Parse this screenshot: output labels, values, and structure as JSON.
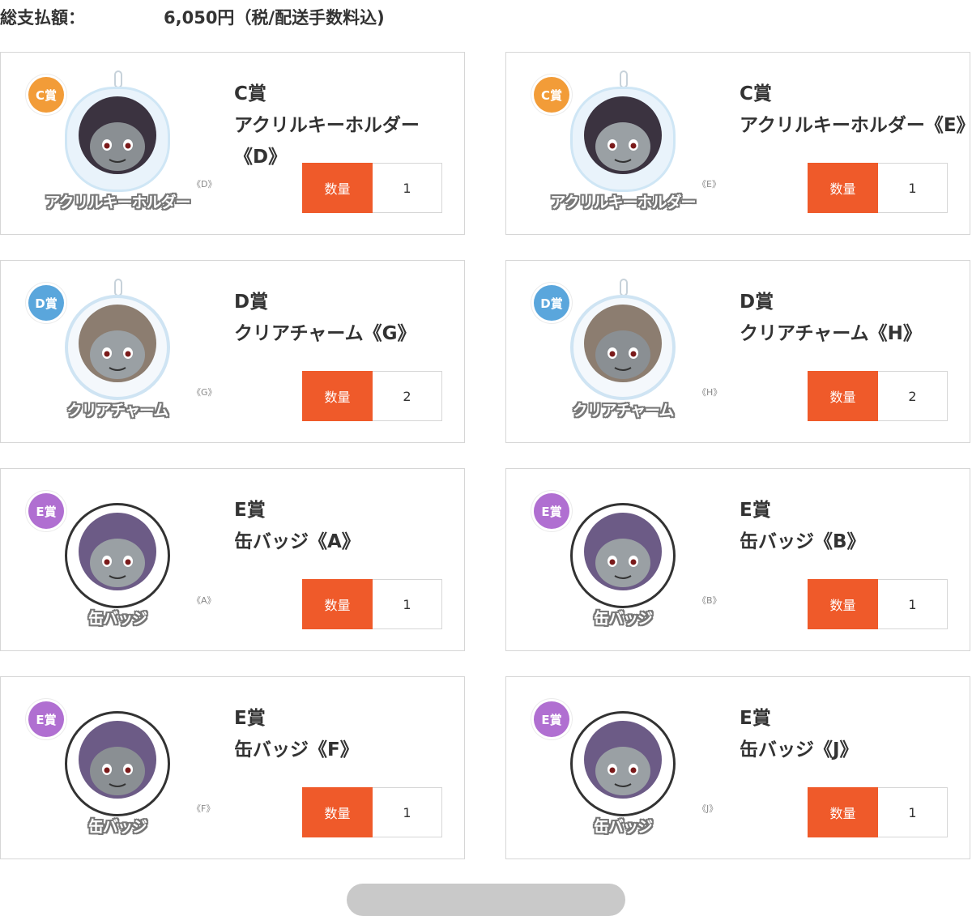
{
  "total": {
    "label": "総支払額：",
    "amount": "6,050円（税/配送手数料込)"
  },
  "qty_label": "数量",
  "colors": {
    "accent": "#ef5a2a",
    "border": "#d6d6d6",
    "badge_C": "#f29c38",
    "badge_D": "#5aa6dc",
    "badge_E": "#b06fd1"
  },
  "items": [
    {
      "rank": "C",
      "badge_text": "C賞",
      "grade": "C賞",
      "name": "アクリルキーホルダー《D》",
      "caption": "アクリルキーホルダー",
      "variant": "《D》",
      "qty": "1",
      "kind": "acrylic",
      "icon": "acrylic-keychain-icon"
    },
    {
      "rank": "C",
      "badge_text": "C賞",
      "grade": "C賞",
      "name": "アクリルキーホルダー《E》",
      "caption": "アクリルキーホルダー",
      "variant": "《E》",
      "qty": "1",
      "kind": "acrylic",
      "icon": "acrylic-keychain-icon"
    },
    {
      "rank": "D",
      "badge_text": "D賞",
      "grade": "D賞",
      "name": "クリアチャーム《G》",
      "caption": "クリアチャーム",
      "variant": "《G》",
      "qty": "2",
      "kind": "charm",
      "icon": "clear-charm-icon"
    },
    {
      "rank": "D",
      "badge_text": "D賞",
      "grade": "D賞",
      "name": "クリアチャーム《H》",
      "caption": "クリアチャーム",
      "variant": "《H》",
      "qty": "2",
      "kind": "charm",
      "icon": "clear-charm-icon"
    },
    {
      "rank": "E",
      "badge_text": "E賞",
      "grade": "E賞",
      "name": "缶バッジ《A》",
      "caption": "缶バッジ",
      "variant": "《A》",
      "qty": "1",
      "kind": "badgecan",
      "icon": "can-badge-icon"
    },
    {
      "rank": "E",
      "badge_text": "E賞",
      "grade": "E賞",
      "name": "缶バッジ《B》",
      "caption": "缶バッジ",
      "variant": "《B》",
      "qty": "1",
      "kind": "badgecan",
      "icon": "can-badge-icon"
    },
    {
      "rank": "E",
      "badge_text": "E賞",
      "grade": "E賞",
      "name": "缶バッジ《F》",
      "caption": "缶バッジ",
      "variant": "《F》",
      "qty": "1",
      "kind": "badgecan",
      "icon": "can-badge-icon"
    },
    {
      "rank": "E",
      "badge_text": "E賞",
      "grade": "E賞",
      "name": "缶バッジ《J》",
      "caption": "缶バッジ",
      "variant": "《J》",
      "qty": "1",
      "kind": "badgecan",
      "icon": "can-badge-icon"
    }
  ]
}
